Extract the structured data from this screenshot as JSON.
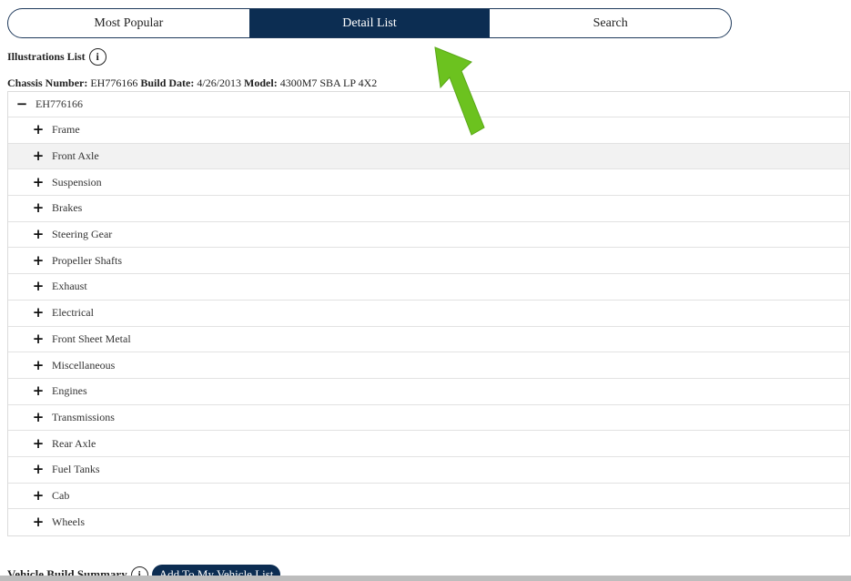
{
  "tabs": [
    {
      "label": "Most Popular",
      "active": false
    },
    {
      "label": "Detail List",
      "active": true
    },
    {
      "label": "Search",
      "active": false
    }
  ],
  "illustrations": {
    "label": "Illustrations List",
    "info_icon": "info-icon"
  },
  "chassis": {
    "number_label": "Chassis Number:",
    "number_value": "EH776166",
    "build_label": "Build Date:",
    "build_value": "4/26/2013",
    "model_label": "Model:",
    "model_value": "4300M7 SBA LP 4X2"
  },
  "tree": {
    "root": {
      "label": "EH776166",
      "toggle": "−"
    },
    "items": [
      {
        "label": "Frame",
        "toggle": "+"
      },
      {
        "label": "Front Axle",
        "toggle": "+"
      },
      {
        "label": "Suspension",
        "toggle": "+"
      },
      {
        "label": "Brakes",
        "toggle": "+"
      },
      {
        "label": "Steering Gear",
        "toggle": "+"
      },
      {
        "label": "Propeller Shafts",
        "toggle": "+"
      },
      {
        "label": "Exhaust",
        "toggle": "+"
      },
      {
        "label": "Electrical",
        "toggle": "+"
      },
      {
        "label": "Front Sheet Metal",
        "toggle": "+"
      },
      {
        "label": "Miscellaneous",
        "toggle": "+"
      },
      {
        "label": "Engines",
        "toggle": "+"
      },
      {
        "label": "Transmissions",
        "toggle": "+"
      },
      {
        "label": "Rear Axle",
        "toggle": "+"
      },
      {
        "label": "Fuel Tanks",
        "toggle": "+"
      },
      {
        "label": "Cab",
        "toggle": "+"
      },
      {
        "label": "Wheels",
        "toggle": "+"
      }
    ]
  },
  "summary": {
    "label": "Vehicle Build Summary",
    "add_button": "Add To My Vehicle List"
  },
  "colors": {
    "nav_dark": "#0c2d52",
    "arrow_green": "#6cc21f"
  }
}
